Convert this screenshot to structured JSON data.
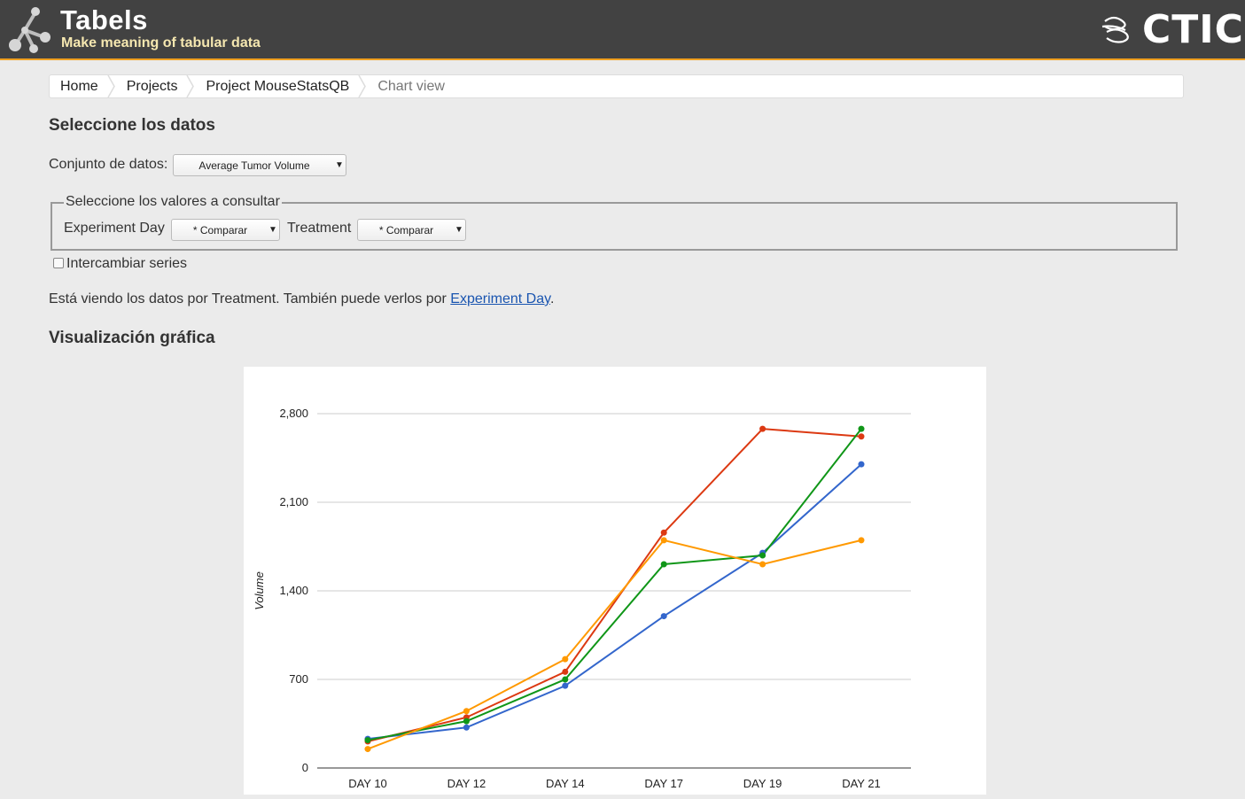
{
  "app": {
    "title": "Tabels",
    "subtitle": "Make meaning of tabular data",
    "brand_logo_text": "CTIC",
    "accent_color": "#f0a020"
  },
  "breadcrumb": [
    {
      "label": "Home"
    },
    {
      "label": "Projects"
    },
    {
      "label": "Project MouseStatsQB"
    },
    {
      "label": "Chart view"
    }
  ],
  "data_selection": {
    "heading": "Seleccione los datos",
    "dataset_label": "Conjunto de datos:",
    "dataset_value": "Average Tumor Volume",
    "values_legend": "Seleccione los valores a consultar",
    "filters": [
      {
        "label": "Experiment Day",
        "value": "* Comparar"
      },
      {
        "label": "Treatment",
        "value": "* Comparar"
      }
    ],
    "swap_series_label": "Intercambiar series",
    "swap_series_checked": false,
    "view_text_before": "Está viendo los datos por Treatment. También puede verlos por ",
    "view_link": "Experiment Day",
    "view_text_after": "."
  },
  "visualization": {
    "heading": "Visualización gráfica"
  },
  "chart_data": {
    "type": "line",
    "title": "",
    "xlabel": "",
    "ylabel": "Volume",
    "categories": [
      "DAY 10",
      "DAY 12",
      "DAY 14",
      "DAY 17",
      "DAY 19",
      "DAY 21"
    ],
    "ylim": [
      0,
      2800
    ],
    "yticks": [
      0,
      700,
      1400,
      2100,
      2800
    ],
    "ytick_labels": [
      "0",
      "700",
      "1,400",
      "2,100",
      "2,800"
    ],
    "grid": true,
    "series": [
      {
        "color": "#3366cc",
        "values": [
          230,
          320,
          650,
          1200,
          1700,
          2400
        ]
      },
      {
        "color": "#dc3912",
        "values": [
          210,
          400,
          760,
          1860,
          2680,
          2620
        ]
      },
      {
        "color": "#109618",
        "values": [
          220,
          370,
          700,
          1610,
          1680,
          2680
        ]
      },
      {
        "color": "#ff9900",
        "values": [
          150,
          450,
          860,
          1800,
          1610,
          1800
        ]
      }
    ]
  }
}
